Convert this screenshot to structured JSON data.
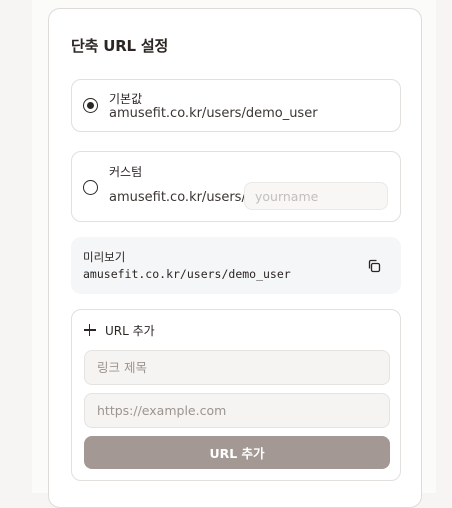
{
  "section": {
    "title": "단축 URL 설정"
  },
  "options": {
    "default": {
      "label": "기본값",
      "url": "amusefit.co.kr/users/demo_user",
      "selected": true
    },
    "custom": {
      "label": "커스텀",
      "prefix": "amusefit.co.kr/users/",
      "input_value": "",
      "input_placeholder": "yourname",
      "selected": false
    }
  },
  "preview": {
    "label": "미리보기",
    "url": "amusefit.co.kr/users/demo_user",
    "copy_icon": "copy-icon"
  },
  "add_url": {
    "header_label": "URL 추가",
    "header_icon": "plus-icon",
    "title_placeholder": "링크 제목",
    "url_placeholder": "https://example.com",
    "submit_label": "URL 추가"
  },
  "colors": {
    "accent_button": "#a39893",
    "text": "#2b2623",
    "preview_bg": "#f5f6f8"
  }
}
